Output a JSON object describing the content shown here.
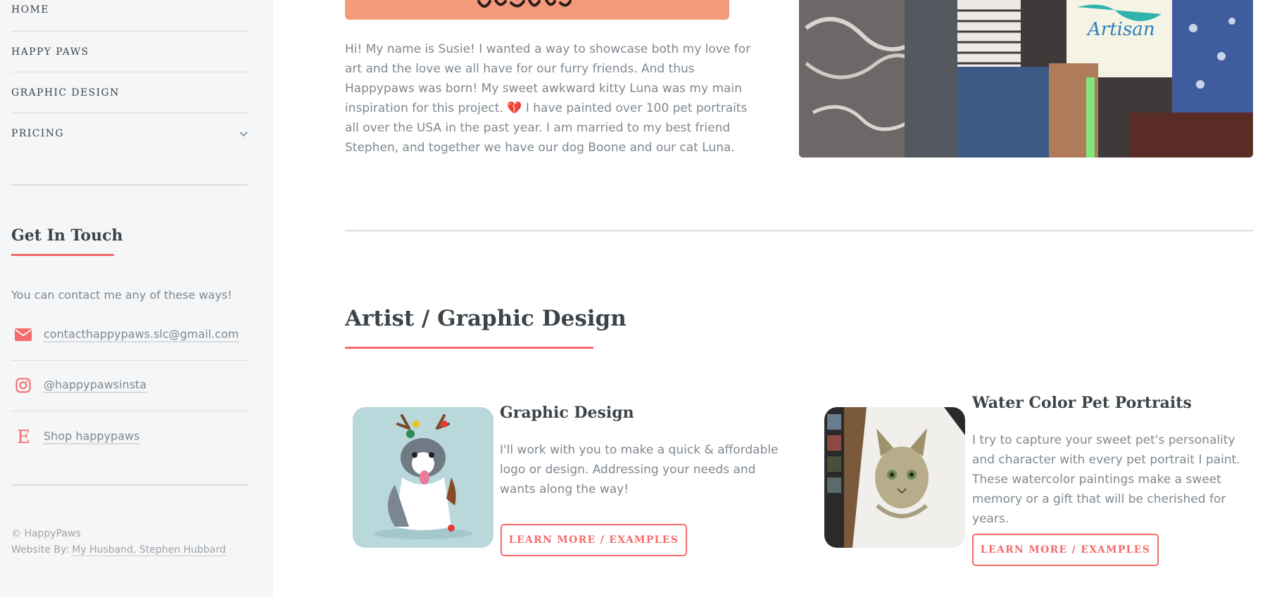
{
  "sidebar": {
    "nav": [
      {
        "label": "HOME"
      },
      {
        "label": "HAPPY PAWS"
      },
      {
        "label": "GRAPHIC DESIGN"
      },
      {
        "label": "PRICING"
      }
    ],
    "get_in_touch": {
      "title": "Get In Touch",
      "intro": "You can contact me any of these ways!",
      "contacts": [
        {
          "icon": "envelope-icon",
          "text": "contacthappypaws.slc@gmail.com"
        },
        {
          "icon": "instagram-icon",
          "text": "@happypawsinsta"
        },
        {
          "icon": "etsy-icon",
          "text": "Shop happypaws"
        }
      ]
    },
    "footer": {
      "copyright": "© HappyPaws",
      "credit_prefix": "Website By: ",
      "credit_link": "My Husband, Stephen Hubbard"
    }
  },
  "main": {
    "bio": "Hi! My name is Susie! I wanted a way to showcase both my love for art and the love we all have for our furry friends. And thus Happypaws was born! My sweet awkward kitty Luna was my main inspiration for this project. ",
    "bio_heart": "💔",
    "bio_end": " I have painted over 100 pet portraits all over the USA in the past year. I am married to my best friend Stephen, and together we have our dog Boone and our cat Luna.",
    "section_title": "Artist / Graphic Design",
    "cards": [
      {
        "title": "Graphic Design",
        "text": "I'll work with you to make a quick & affordable logo or design. Addressing your needs and wants along the way!",
        "button": "LEARN MORE / EXAMPLES"
      },
      {
        "title": "Water Color Pet Portraits",
        "text": "I try to capture your sweet pet's personality and character with every pet portrait I paint. These watercolor paintings make a sweet memory or a gift that will be cherished for years.",
        "button": "LEARN MORE / EXAMPLES"
      }
    ]
  },
  "colors": {
    "accent": "#f56a6a",
    "sidebar_bg": "#f5f6f7",
    "heading": "#3d4449",
    "body_text": "#7f888f"
  }
}
